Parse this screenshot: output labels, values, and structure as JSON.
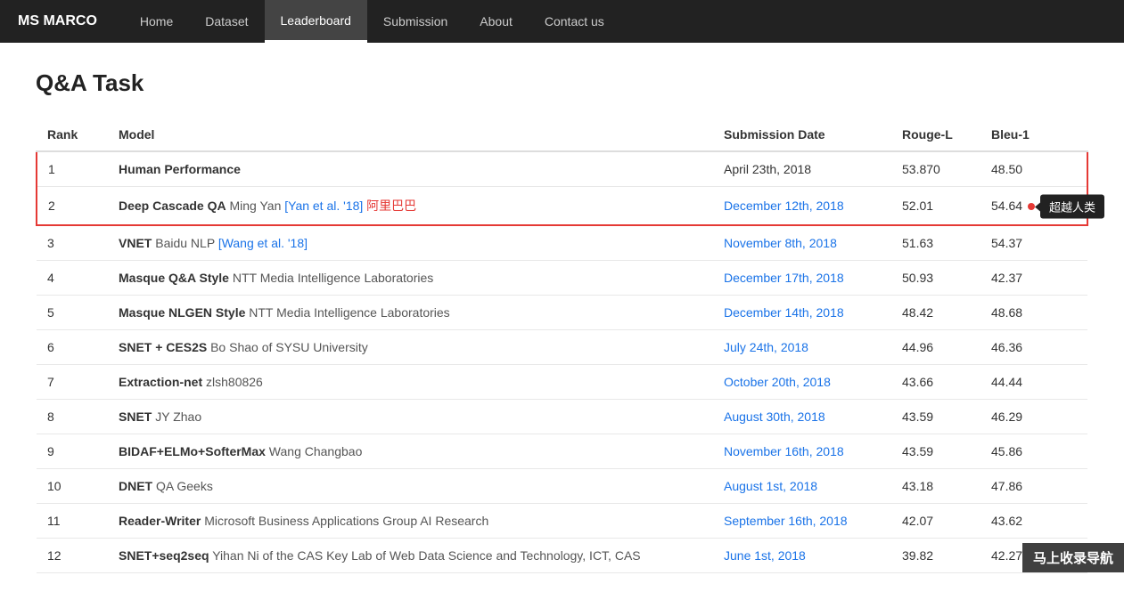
{
  "brand": "MS MARCO",
  "nav": {
    "items": [
      {
        "label": "Home",
        "active": false
      },
      {
        "label": "Dataset",
        "active": false
      },
      {
        "label": "Leaderboard",
        "active": true
      },
      {
        "label": "Submission",
        "active": false
      },
      {
        "label": "About",
        "active": false
      },
      {
        "label": "Contact us",
        "active": false
      }
    ]
  },
  "page": {
    "title": "Q&A Task"
  },
  "table": {
    "headers": {
      "rank": "Rank",
      "model": "Model",
      "submission_date": "Submission Date",
      "rouge_l": "Rouge-L",
      "bleu_1": "Bleu-1"
    },
    "rows": [
      {
        "rank": "1",
        "model_bold": "Human Performance",
        "model_sub": "",
        "date": "April 23th, 2018",
        "date_link": false,
        "rouge": "53.870",
        "bleu": "48.50",
        "highlight": "top",
        "has_dot": false,
        "has_chinese_link": false
      },
      {
        "rank": "2",
        "model_bold": "Deep Cascade QA",
        "model_sub_before_link": "Ming Yan ",
        "link_text": "[Yan et al. '18]",
        "model_sub_after_link": "   阿里巴巴",
        "date": "December 12th, 2018",
        "date_link": true,
        "rouge": "52.01",
        "bleu": "54.64",
        "highlight": "bottom",
        "has_dot": true,
        "tooltip": "超越人类",
        "has_chinese_link": true
      },
      {
        "rank": "3",
        "model_bold": "VNET",
        "model_sub_before_link": "Baidu NLP ",
        "link_text": "[Wang et al. '18]",
        "model_sub_after_link": "",
        "date": "November 8th, 2018",
        "date_link": true,
        "rouge": "51.63",
        "bleu": "54.37",
        "highlight": ""
      },
      {
        "rank": "4",
        "model_bold": "Masque Q&A Style",
        "model_sub": "NTT Media Intelligence Laboratories",
        "date": "December 17th, 2018",
        "date_link": true,
        "rouge": "50.93",
        "bleu": "42.37",
        "highlight": ""
      },
      {
        "rank": "5",
        "model_bold": "Masque NLGEN Style",
        "model_sub": "NTT Media Intelligence Laboratories",
        "date": "December 14th, 2018",
        "date_link": true,
        "rouge": "48.42",
        "bleu": "48.68",
        "highlight": ""
      },
      {
        "rank": "6",
        "model_bold": "SNET + CES2S",
        "model_sub": "Bo Shao of SYSU University",
        "date": "July 24th, 2018",
        "date_link": true,
        "rouge": "44.96",
        "bleu": "46.36",
        "highlight": ""
      },
      {
        "rank": "7",
        "model_bold": "Extraction-net",
        "model_sub": "zlsh80826",
        "date": "October 20th, 2018",
        "date_link": true,
        "rouge": "43.66",
        "bleu": "44.44",
        "highlight": ""
      },
      {
        "rank": "8",
        "model_bold": "SNET",
        "model_sub": "JY Zhao",
        "date": "August 30th, 2018",
        "date_link": true,
        "rouge": "43.59",
        "bleu": "46.29",
        "highlight": ""
      },
      {
        "rank": "9",
        "model_bold": "BIDAF+ELMo+SofterMax",
        "model_sub": "Wang Changbao",
        "date": "November 16th, 2018",
        "date_link": true,
        "rouge": "43.59",
        "bleu": "45.86",
        "highlight": ""
      },
      {
        "rank": "10",
        "model_bold": "DNET",
        "model_sub": "QA Geeks",
        "date": "August 1st, 2018",
        "date_link": true,
        "rouge": "43.18",
        "bleu": "47.86",
        "highlight": ""
      },
      {
        "rank": "11",
        "model_bold": "Reader-Writer",
        "model_sub": "Microsoft Business Applications Group AI Research",
        "date": "September 16th, 2018",
        "date_link": true,
        "rouge": "42.07",
        "bleu": "43.62",
        "highlight": ""
      },
      {
        "rank": "12",
        "model_bold": "SNET+seq2seq",
        "model_sub": "Yihan Ni of the CAS Key Lab of Web Data Science and Technology, ICT, CAS",
        "date": "June 1st, 2018",
        "date_link": true,
        "rouge": "39.82",
        "bleu": "42.27",
        "highlight": ""
      }
    ]
  },
  "watermark": "马上收录导航"
}
